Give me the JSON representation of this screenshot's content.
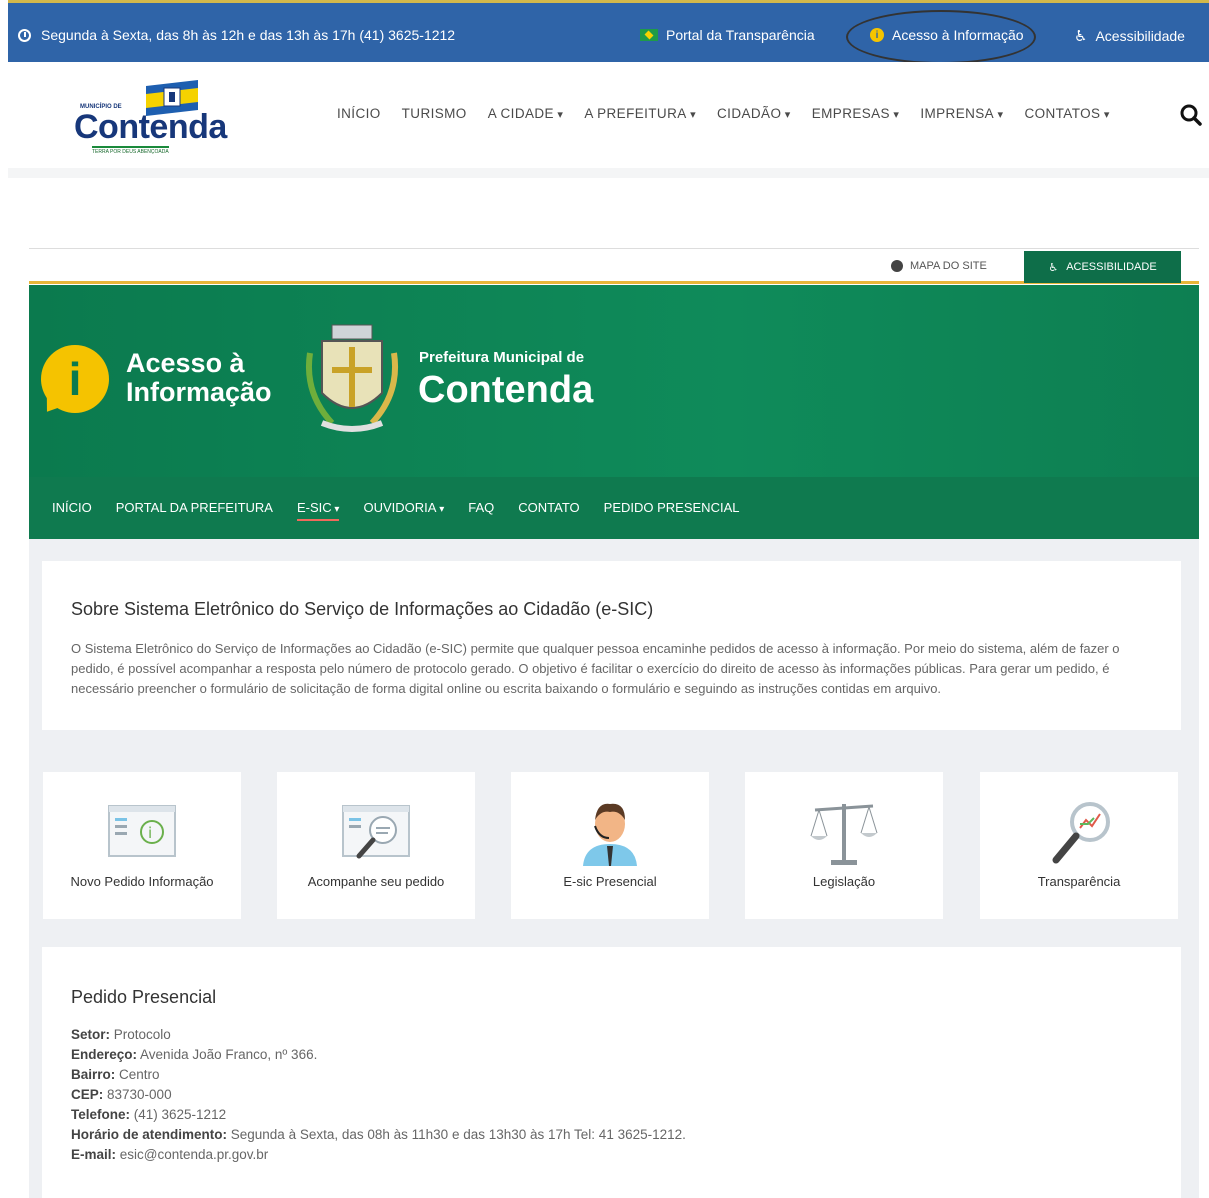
{
  "topbar": {
    "hours": "Segunda à Sexta, das 8h às 12h e das 13h às 17h (41) 3625-1212",
    "transparency": "Portal da Transparência",
    "access_info": "Acesso à Informação",
    "accessibility": "Acessibilidade"
  },
  "logo": {
    "municipio": "MUNICÍPIO DE",
    "name": "Contenda",
    "tagline": "TERRA POR DEUS ABENÇOADA"
  },
  "main_nav": [
    "INÍCIO",
    "TURISMO",
    "A CIDADE",
    "A PREFEITURA",
    "CIDADÃO",
    "EMPRESAS",
    "IMPRENSA",
    "CONTATOS"
  ],
  "util": {
    "sitemap": "MAPA DO SITE",
    "accessibility": "ACESSIBILIDADE"
  },
  "banner": {
    "ai_title_line1": "Acesso à",
    "ai_title_line2": "Informação",
    "pm_small": "Prefeitura Municipal de",
    "pm_big": "Contenda"
  },
  "portal_nav": [
    "INÍCIO",
    "PORTAL DA PREFEITURA",
    "E-SIC",
    "OUVIDORIA",
    "FAQ",
    "CONTATO",
    "PEDIDO PRESENCIAL"
  ],
  "about": {
    "title": "Sobre Sistema Eletrônico do Serviço de Informações ao Cidadão (e-SIC)",
    "text": "O Sistema Eletrônico do Serviço de Informações ao Cidadão (e-SIC) permite que qualquer pessoa encaminhe pedidos de acesso à informação. Por meio do sistema, além de fazer o pedido, é possível acompanhar a resposta pelo número de protocolo gerado. O objetivo é facilitar o exercício do direito de acesso às informações públicas. Para gerar um pedido, é necessário preencher o formulário de solicitação de forma digital online ou escrita baixando o formulário e seguindo as instruções contidas em arquivo."
  },
  "cards": [
    {
      "label": "Novo Pedido Informação",
      "icon": "new-request-icon"
    },
    {
      "label": "Acompanhe seu pedido",
      "icon": "track-request-icon"
    },
    {
      "label": "E-sic Presencial",
      "icon": "attendant-icon"
    },
    {
      "label": "Legislação",
      "icon": "scales-icon"
    },
    {
      "label": "Transparência",
      "icon": "magnifier-chart-icon"
    }
  ],
  "presencial": {
    "title": "Pedido Presencial",
    "setor_label": "Setor:",
    "setor": " Protocolo",
    "endereco_label": "Endereço:",
    "endereco": " Avenida João Franco, nº 366.",
    "bairro_label": "Bairro:",
    "bairro": " Centro",
    "cep_label": "CEP:",
    "cep": " 83730-000",
    "telefone_label": "Telefone:",
    "telefone": " (41) 3625-1212",
    "horario_label": "Horário de atendimento:",
    "horario": " Segunda à Sexta, das 08h às 11h30 e das 13h30 às 17h Tel: 41 3625-1212.",
    "email_label": "E-mail:",
    "email": " esic@contenda.pr.gov.br"
  },
  "colors": {
    "topbar": "#2f64a8",
    "portal_green": "#0f7a4f",
    "yellow": "#f5c300"
  }
}
